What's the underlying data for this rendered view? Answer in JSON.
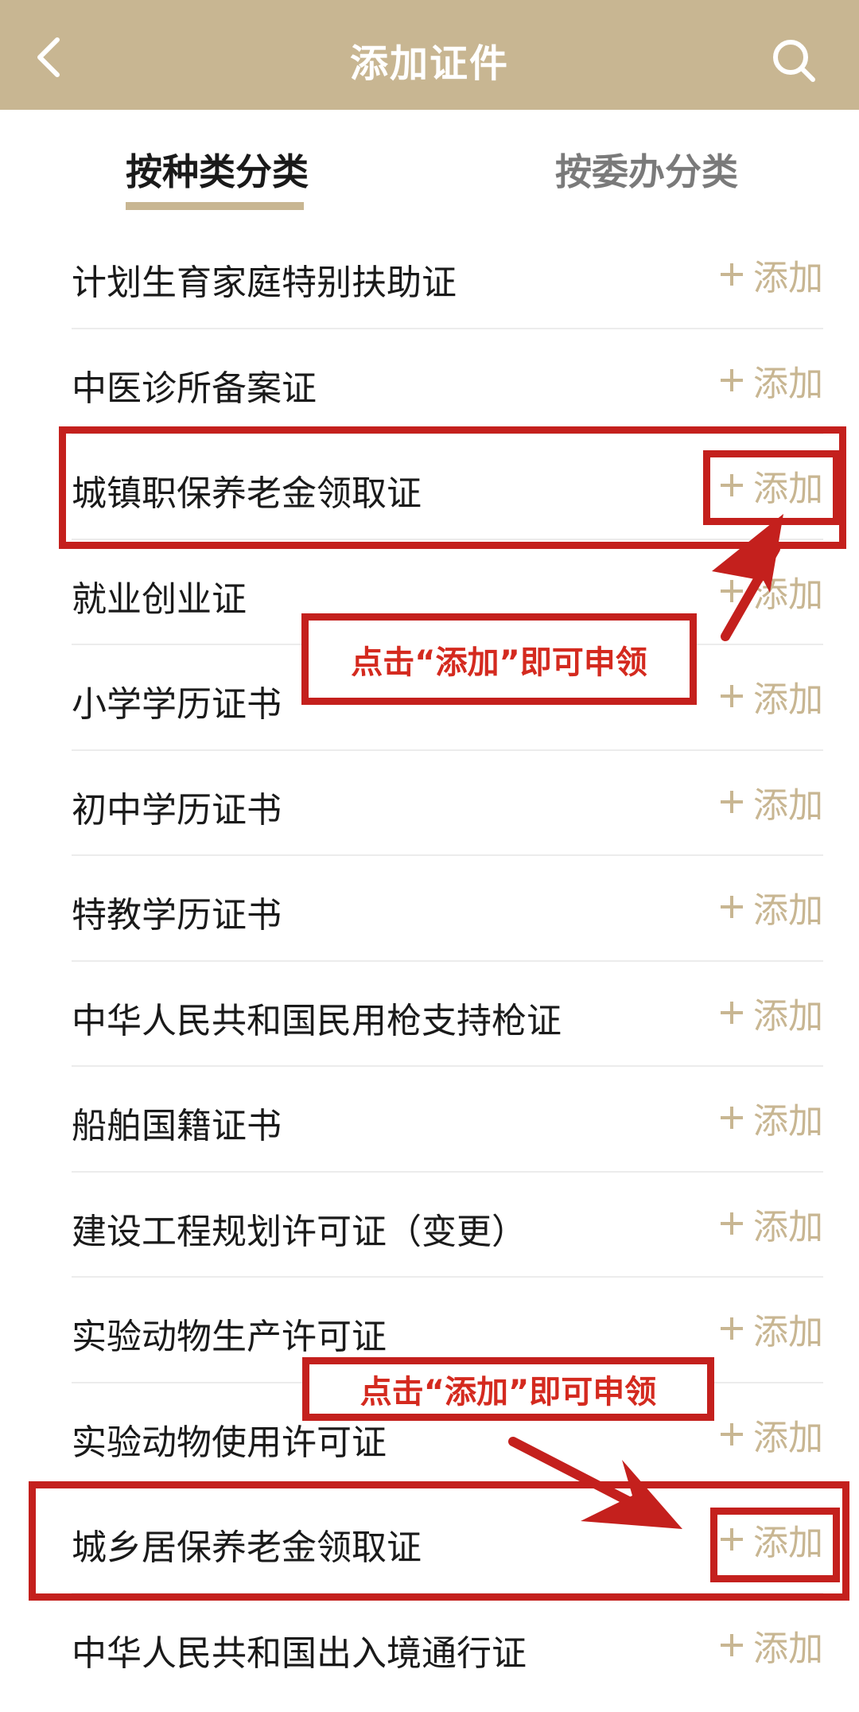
{
  "header": {
    "title": "添加证件",
    "back_icon": "chevron-left-icon",
    "search_icon": "search-icon",
    "background": "#c8b692"
  },
  "tabs": [
    {
      "label": "按种类分类",
      "active": true
    },
    {
      "label": "按委办分类",
      "active": false
    }
  ],
  "add_label": "添加",
  "add_icon": "plus-icon",
  "accent_color": "#c8b692",
  "annotation_color": "#c4201d",
  "items": [
    {
      "name": "计划生育家庭特别扶助证"
    },
    {
      "name": "中医诊所备案证"
    },
    {
      "name": "城镇职保养老金领取证"
    },
    {
      "name": "就业创业证"
    },
    {
      "name": "小学学历证书"
    },
    {
      "name": "初中学历证书"
    },
    {
      "name": "特教学历证书"
    },
    {
      "name": "中华人民共和国民用枪支持枪证"
    },
    {
      "name": "船舶国籍证书"
    },
    {
      "name": "建设工程规划许可证（变更）"
    },
    {
      "name": "实验动物生产许可证"
    },
    {
      "name": "实验动物使用许可证"
    },
    {
      "name": "城乡居保养老金领取证"
    },
    {
      "name": "中华人民共和国出入境通行证"
    }
  ],
  "annotations": {
    "label_1": "点击“添加”即可申领",
    "label_2": "点击“添加”即可申领"
  }
}
